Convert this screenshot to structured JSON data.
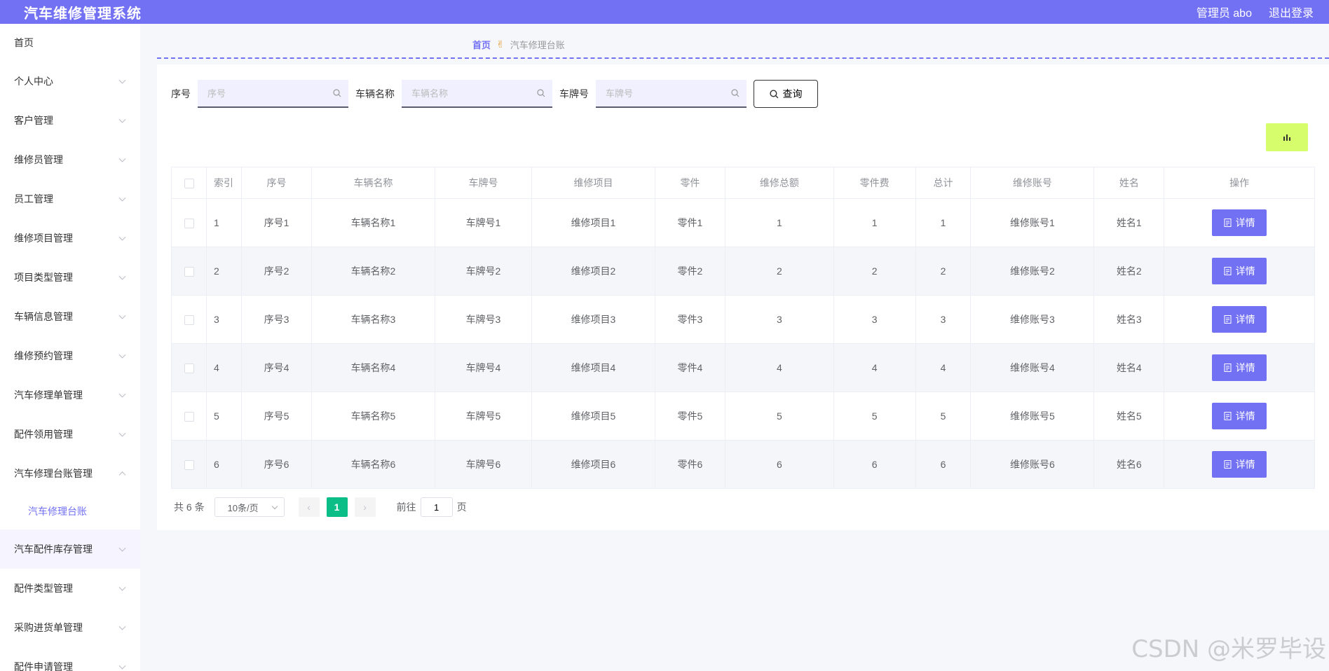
{
  "app": {
    "title": "汽车维修管理系统",
    "user_label": "管理员 abo",
    "logout_label": "退出登录",
    "accent_color": "#7371f3"
  },
  "sidebar": {
    "items": [
      {
        "label": "首页",
        "has_arrow": false
      },
      {
        "label": "个人中心",
        "has_arrow": true
      },
      {
        "label": "客户管理",
        "has_arrow": true
      },
      {
        "label": "维修员管理",
        "has_arrow": true
      },
      {
        "label": "员工管理",
        "has_arrow": true
      },
      {
        "label": "维修项目管理",
        "has_arrow": true
      },
      {
        "label": "项目类型管理",
        "has_arrow": true
      },
      {
        "label": "车辆信息管理",
        "has_arrow": true
      },
      {
        "label": "维修预约管理",
        "has_arrow": true
      },
      {
        "label": "汽车修理单管理",
        "has_arrow": true
      },
      {
        "label": "配件领用管理",
        "has_arrow": true
      },
      {
        "label": "汽车修理台账管理",
        "has_arrow": true,
        "expanded": true
      },
      {
        "label": "汽车配件库存管理",
        "has_arrow": true
      },
      {
        "label": "配件类型管理",
        "has_arrow": true
      },
      {
        "label": "采购进货单管理",
        "has_arrow": true
      },
      {
        "label": "配件申请管理",
        "has_arrow": true
      }
    ],
    "submenu_label": "汽车修理台账"
  },
  "breadcrumb": {
    "home": "首页",
    "separator_icon": "hand-icon",
    "current": "汽车修理台账"
  },
  "search": {
    "fields": [
      {
        "label": "序号",
        "placeholder": "序号"
      },
      {
        "label": "车辆名称",
        "placeholder": "车辆名称"
      },
      {
        "label": "车牌号",
        "placeholder": "车牌号"
      }
    ],
    "query_label": "查询",
    "chart_button_color": "#d6fd6b"
  },
  "table": {
    "headers": [
      "索引",
      "序号",
      "车辆名称",
      "车牌号",
      "维修项目",
      "零件",
      "维修总额",
      "零件费",
      "总计",
      "维修账号",
      "姓名",
      "操作"
    ],
    "detail_label": "详情",
    "rows": [
      [
        "1",
        "序号1",
        "车辆名称1",
        "车牌号1",
        "维修项目1",
        "零件1",
        "1",
        "1",
        "1",
        "维修账号1",
        "姓名1"
      ],
      [
        "2",
        "序号2",
        "车辆名称2",
        "车牌号2",
        "维修项目2",
        "零件2",
        "2",
        "2",
        "2",
        "维修账号2",
        "姓名2"
      ],
      [
        "3",
        "序号3",
        "车辆名称3",
        "车牌号3",
        "维修项目3",
        "零件3",
        "3",
        "3",
        "3",
        "维修账号3",
        "姓名3"
      ],
      [
        "4",
        "序号4",
        "车辆名称4",
        "车牌号4",
        "维修项目4",
        "零件4",
        "4",
        "4",
        "4",
        "维修账号4",
        "姓名4"
      ],
      [
        "5",
        "序号5",
        "车辆名称5",
        "车牌号5",
        "维修项目5",
        "零件5",
        "5",
        "5",
        "5",
        "维修账号5",
        "姓名5"
      ],
      [
        "6",
        "序号6",
        "车辆名称6",
        "车牌号6",
        "维修项目6",
        "零件6",
        "6",
        "6",
        "6",
        "维修账号6",
        "姓名6"
      ]
    ]
  },
  "pagination": {
    "total": "共 6 条",
    "page_size": "10条/页",
    "current_page": "1",
    "goto_prefix": "前往",
    "goto_value": "1",
    "goto_suffix": "页"
  },
  "watermark": "CSDN @米罗毕设"
}
